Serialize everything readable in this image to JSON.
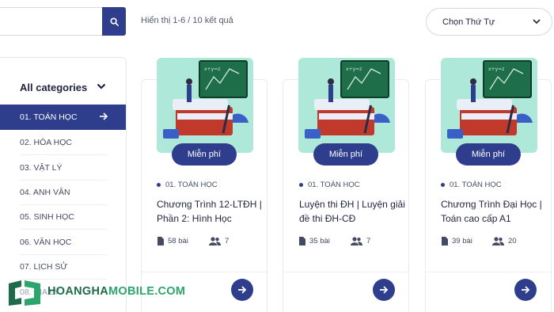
{
  "search": {
    "placeholder": ""
  },
  "results": {
    "text": "Hiển thị 1-6 / 10 kết quả"
  },
  "sort": {
    "label": "Chọn Thứ Tự"
  },
  "sidebar": {
    "heading": "All categories",
    "items": [
      {
        "label": "01. TOÁN HỌC",
        "active": true
      },
      {
        "label": "02. HÓA HỌC"
      },
      {
        "label": "03. VẬT LÝ"
      },
      {
        "label": "04. ANH VĂN"
      },
      {
        "label": "05. SINH HỌC"
      },
      {
        "label": "06. VĂN HỌC"
      },
      {
        "label": "07. LỊCH SỬ"
      },
      {
        "label": "08. ĐỊA LÝ"
      }
    ]
  },
  "courses": [
    {
      "badge": "Miễn phí",
      "category": "01. TOÁN HỌC",
      "title": "Chương Trình 12-LTĐH | Phần 2: Hình Học",
      "lessons": "58 bài",
      "students": "7"
    },
    {
      "badge": "Miễn phí",
      "category": "01. TOÁN HỌC",
      "title": "Luyện thi ĐH | Luyện giải đề thi ĐH-CĐ",
      "lessons": "35 bài",
      "students": "7"
    },
    {
      "badge": "Miễn phí",
      "category": "01. TOÁN HỌC",
      "title": "Chương Trình Đại Học | Toán cao cấp A1",
      "lessons": "39 bài",
      "students": "20"
    }
  ],
  "watermark": {
    "part1": "HOANGHA",
    "part2": "MOBILE.COM"
  },
  "colors": {
    "primary": "#2e3e8c",
    "thumb_bg": "#aee8d8",
    "watermark": "#1d6b4a"
  }
}
